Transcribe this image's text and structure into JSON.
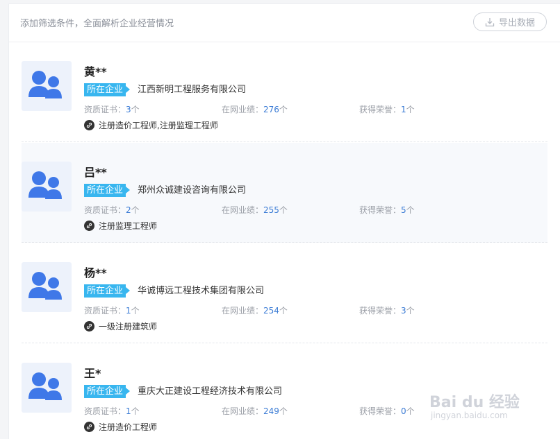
{
  "toolbar": {
    "hint": "添加筛选条件，全面解析企业经营情况",
    "export_label": "导出数据"
  },
  "labels": {
    "company_tag": "所在企业",
    "cert_label": "资质证书：",
    "perf_label": "在网业绩：",
    "honor_label": "获得荣誉：",
    "unit": "个"
  },
  "people": [
    {
      "name": "黄**",
      "company": "江西新明工程服务有限公司",
      "certs": "3",
      "performance": "276",
      "honors": "1",
      "qualifications": "注册造价工程师,注册监理工程师"
    },
    {
      "name": "吕**",
      "company": "郑州众诚建设咨询有限公司",
      "certs": "2",
      "performance": "255",
      "honors": "5",
      "qualifications": "注册监理工程师"
    },
    {
      "name": "杨**",
      "company": "华诚博远工程技术集团有限公司",
      "certs": "1",
      "performance": "254",
      "honors": "3",
      "qualifications": "一级注册建筑师"
    },
    {
      "name": "王*",
      "company": "重庆大正建设工程经济技术有限公司",
      "certs": "1",
      "performance": "249",
      "honors": "0",
      "qualifications": "注册造价工程师"
    }
  ],
  "watermark": {
    "main": "Bai du 经验",
    "sub": "jingyan.baidu.com"
  },
  "colors": {
    "accent": "#38b6ef",
    "value": "#3a7bd5",
    "avatar": "#3f78e8"
  }
}
